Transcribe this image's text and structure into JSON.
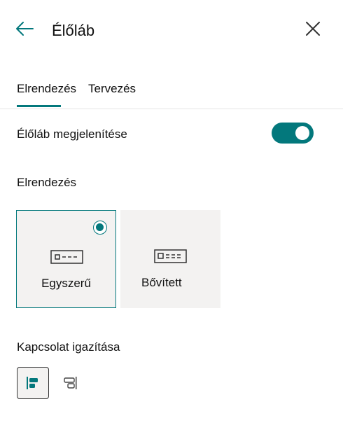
{
  "header": {
    "title": "Élőláb",
    "back_icon": "back-arrow-icon",
    "close_icon": "close-icon"
  },
  "tabs": [
    {
      "label": "Elrendezés",
      "active": true
    },
    {
      "label": "Tervezés",
      "active": false
    }
  ],
  "footer_toggle": {
    "label": "Élőláb megjelenítése",
    "on": true
  },
  "layout_section": {
    "heading": "Elrendezés",
    "options": [
      {
        "label": "Egyszerű",
        "selected": true,
        "icon": "simple-layout-icon"
      },
      {
        "label": "Bővített",
        "selected": false,
        "icon": "extended-layout-icon"
      }
    ]
  },
  "link_alignment": {
    "heading": "Kapcsolat igazítása",
    "options": [
      {
        "icon": "align-left-icon",
        "selected": true
      },
      {
        "icon": "align-right-icon",
        "selected": false
      }
    ]
  },
  "colors": {
    "accent": "#03787c",
    "card_bg": "#f3f2f1"
  }
}
